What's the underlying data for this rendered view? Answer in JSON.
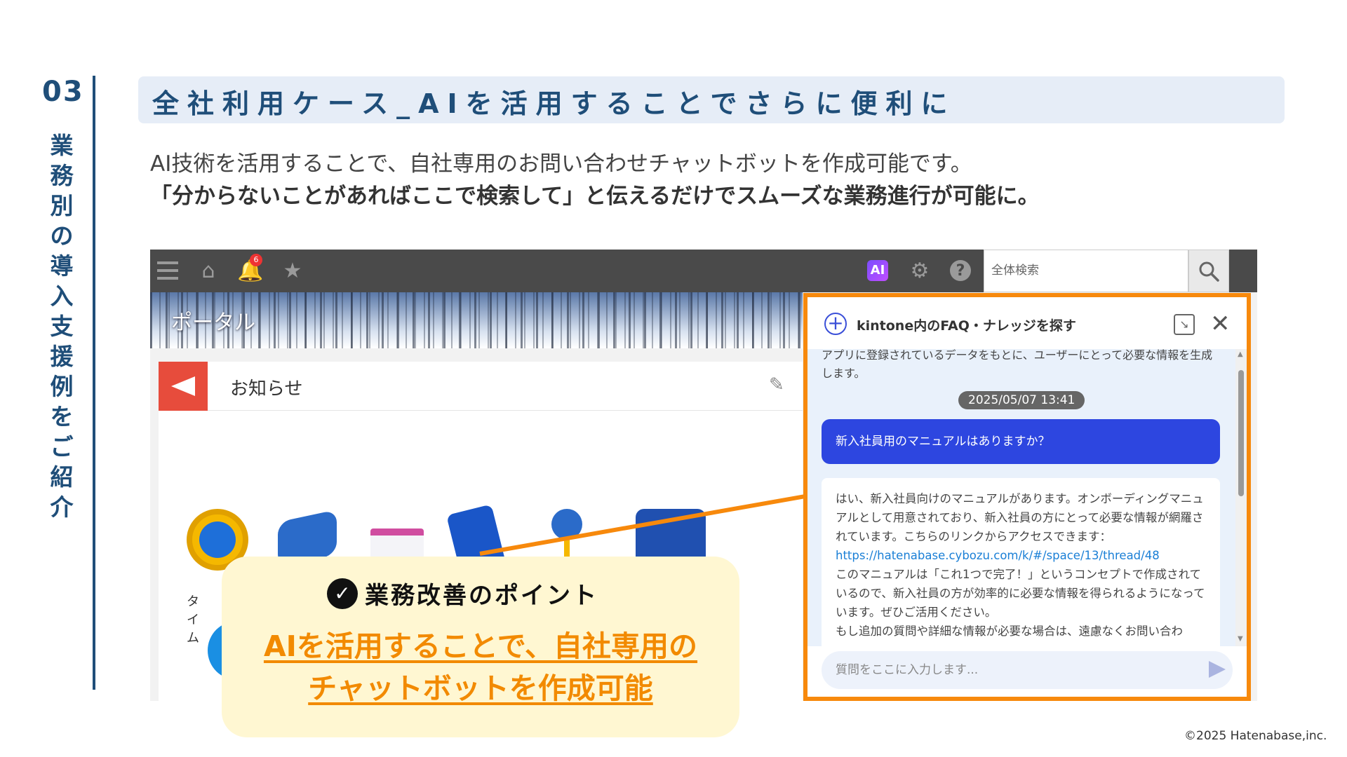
{
  "section": {
    "number": "03",
    "vertical_title": "業務別の導入支援例をご紹介"
  },
  "title": "全社利用ケース_AIを活用することでさらに便利に",
  "lead": {
    "line1": "AI技術を活用することで、自社専用のお問い合わせチャットボットを作成可能です。",
    "line2": "「分からないことがあればここで検索して」と伝えるだけでスムーズな業務進行が可能に。"
  },
  "kintone": {
    "notification_count": "6",
    "ai_label": "AI",
    "search_placeholder": "全体検索",
    "banner_title": "ポータル",
    "notice_label": "お知らせ",
    "app_label_partial": "タイム"
  },
  "chat": {
    "title": "kintone内のFAQ・ナレッジを探す",
    "intro": "アプリに登録されているデータをもとに、ユーザーにとって必要な情報を生成します。",
    "timestamp": "2025/05/07 13:41",
    "user_message": "新入社員用のマニュアルはありますか？",
    "bot_line1": "はい、新入社員向けのマニュアルがあります。オンボーディングマニュアルとして用意されており、新入社員の方にとって必要な情報が網羅されています。こちらのリンクからアクセスできます：",
    "bot_link": "https://hatenabase.cybozu.com/k/#/space/13/thread/48",
    "bot_line2": "このマニュアルは「これ1つで完了！」というコンセプトで作成されているので、新入社員の方が効率的に必要な情報を得られるようになっています。ぜひご活用ください。",
    "bot_line3": "もし追加の質問や詳細な情報が必要な場合は、遠慮なくお問い合わ",
    "input_placeholder": "質問をここに入力します..."
  },
  "callout": {
    "title": "業務改善のポイント",
    "line1": "AIを活用することで、自社専用の",
    "line2": "チャットボットを作成可能"
  },
  "copyright": "©2025 Hatenabase,inc.",
  "colors": {
    "navy": "#1f4e79",
    "highlight_orange": "#f7890c",
    "callout_bg": "#fff7d2",
    "user_bubble": "#2d46e0"
  }
}
